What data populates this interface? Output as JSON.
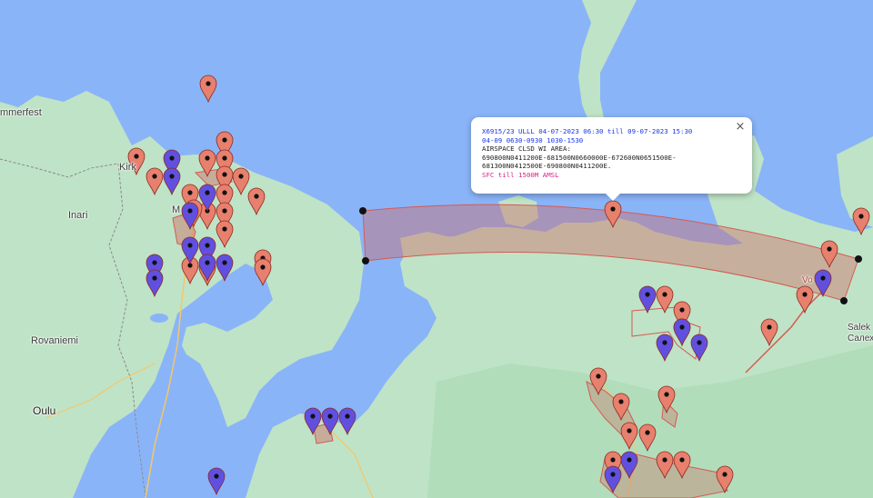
{
  "map": {
    "colors": {
      "water": "#8ab4f8",
      "land": "#bfe3c6",
      "land_dark": "#a8d8b4",
      "road": "#f6c667",
      "pin_red": "#e8806e",
      "pin_blue": "#6150e0",
      "area_fill": "#cf6a63",
      "area_stroke": "#d65a52"
    },
    "labels": {
      "hammerfest": "mmerfest",
      "kirkenes": "Kirk",
      "inari": "Inari",
      "murmansk": "M",
      "rovaniemi": "Rovaniemi",
      "oulu": "Oulu",
      "vorkuta": "Vo",
      "salekhard_latin": "Salek",
      "salekhard_cyr": "Салех"
    },
    "pins_red": 36,
    "pins_blue": 21
  },
  "popup": {
    "line1": "X6915/23 ULLL  04-07-2023 06:30 till 09-07-2023 15:30",
    "line2": "04-09 0630-0930 1030-1530",
    "line3": "AIRSPACE CLSD WI AREA:",
    "line4": "690800N0411200E-681500N0660000E-672600N0651500E-",
    "line5": "681300N0412500E-690800N0411200E.",
    "line6": "SFC  till 1500M AMSL",
    "close": "×"
  }
}
